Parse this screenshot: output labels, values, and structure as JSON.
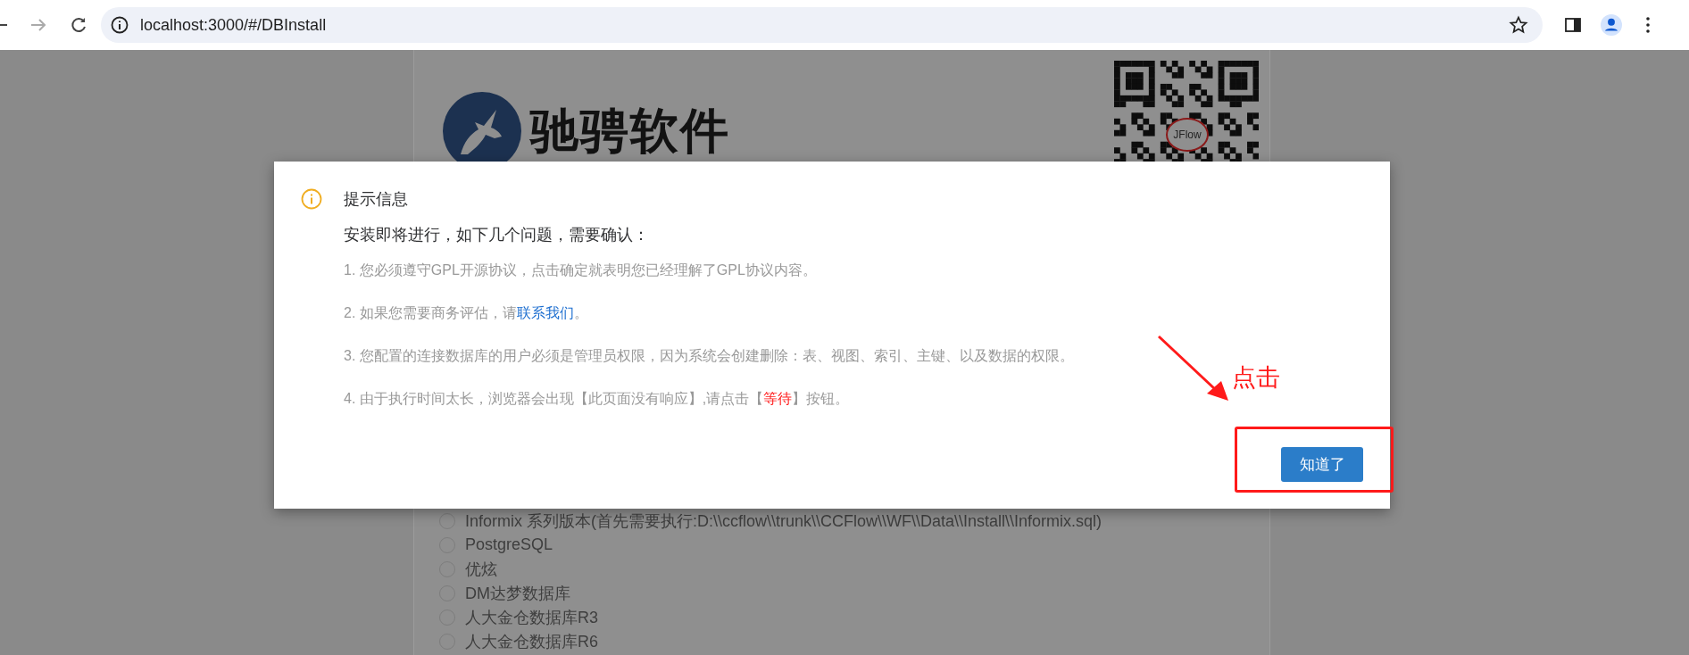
{
  "browser": {
    "url": "localhost:3000/#/DBInstall"
  },
  "logo": {
    "text": "驰骋软件"
  },
  "qr_badge": "JFlow",
  "db_options": [
    {
      "label": "Informix 系列版本(首先需要执行:D:\\\\ccflow\\\\trunk\\\\CCFlow\\\\WF\\\\Data\\\\Install\\\\Informix.sql)",
      "selected": false
    },
    {
      "label": "PostgreSQL",
      "selected": false
    },
    {
      "label": "优炫",
      "selected": false
    },
    {
      "label": "DM达梦数据库",
      "selected": false
    },
    {
      "label": "人大金仓数据库R3",
      "selected": false
    },
    {
      "label": "人大金仓数据库R6",
      "selected": false
    }
  ],
  "dialog": {
    "title": "提示信息",
    "intro": "安装即将进行，如下几个问题，需要确认：",
    "items": [
      {
        "segments": [
          {
            "kind": "plain",
            "text": "1. 您必须遵守GPL开源协议，点击确定就表明您已经理解了GPL协议内容。"
          }
        ]
      },
      {
        "segments": [
          {
            "kind": "plain",
            "text": "2. 如果您需要商务评估，请"
          },
          {
            "kind": "link",
            "text": "联系我们"
          },
          {
            "kind": "plain",
            "text": "。"
          }
        ]
      },
      {
        "segments": [
          {
            "kind": "plain",
            "text": "3. 您配置的连接数据库的用户必须是管理员权限，因为系统会创建删除：表、视图、索引、主键、以及数据的权限。"
          }
        ]
      },
      {
        "segments": [
          {
            "kind": "plain",
            "text": "4. 由于执行时间太长，浏览器会出现【此页面没有响应】,请点击【"
          },
          {
            "kind": "emphasis",
            "text": "等待"
          },
          {
            "kind": "plain",
            "text": "】按钮。"
          }
        ]
      }
    ],
    "button": "知道了"
  },
  "annotation": {
    "label": "点击"
  }
}
